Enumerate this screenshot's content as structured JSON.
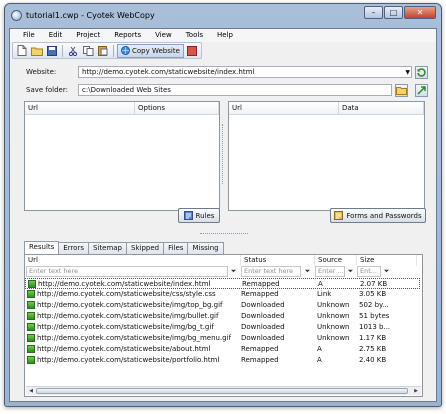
{
  "window": {
    "title": "tutorial1.cwp - Cyotek WebCopy"
  },
  "caption_buttons": {
    "minimize": "–",
    "maximize": "□",
    "close": "✕"
  },
  "menu": [
    "File",
    "Edit",
    "Project",
    "Reports",
    "View",
    "Tools",
    "Help"
  ],
  "toolbar": {
    "copy_website_label": "Copy Website"
  },
  "form": {
    "website_label": "Website:",
    "website_value": "http://demo.cyotek.com/staticwebsite/index.html",
    "save_folder_label": "Save folder:",
    "save_folder_value": "c:\\Downloaded Web Sites"
  },
  "rules_pane": {
    "columns": [
      "Url",
      "Options"
    ]
  },
  "forms_pane": {
    "columns": [
      "Url",
      "Data"
    ]
  },
  "buttons": {
    "rules": "Rules",
    "forms_passwords": "Forms and Passwords"
  },
  "tabs": [
    "Results",
    "Errors",
    "Sitemap",
    "Skipped",
    "Files",
    "Missing"
  ],
  "results": {
    "columns": [
      "Url",
      "Status",
      "Source",
      "Size"
    ],
    "filter_placeholders": [
      "Enter text here",
      "Enter text here",
      "Enter ...",
      "Ent..."
    ],
    "rows": [
      {
        "url": "http://demo.cyotek.com/staticwebsite/index.html",
        "status": "Remapped",
        "source": "A",
        "size": "2.07 KB"
      },
      {
        "url": "http://demo.cyotek.com/staticwebsite/css/style.css",
        "status": "Remapped",
        "source": "Link",
        "size": "3.05 KB"
      },
      {
        "url": "http://demo.cyotek.com/staticwebsite/img/top_bg.gif",
        "status": "Downloaded",
        "source": "Unknown",
        "size": "502 by..."
      },
      {
        "url": "http://demo.cyotek.com/staticwebsite/img/bullet.gif",
        "status": "Downloaded",
        "source": "Unknown",
        "size": "51 bytes"
      },
      {
        "url": "http://demo.cyotek.com/staticwebsite/img/bg_t.gif",
        "status": "Downloaded",
        "source": "Unknown",
        "size": "1013 b..."
      },
      {
        "url": "http://demo.cyotek.com/staticwebsite/img/bg_menu.gif",
        "status": "Downloaded",
        "source": "Unknown",
        "size": "1.17 KB"
      },
      {
        "url": "http://demo.cyotek.com/staticwebsite/about.html",
        "status": "Remapped",
        "source": "A",
        "size": "2.75 KB"
      },
      {
        "url": "http://demo.cyotek.com/staticwebsite/portfolio.html",
        "status": "Remapped",
        "source": "A",
        "size": "2.40 KB"
      }
    ]
  }
}
